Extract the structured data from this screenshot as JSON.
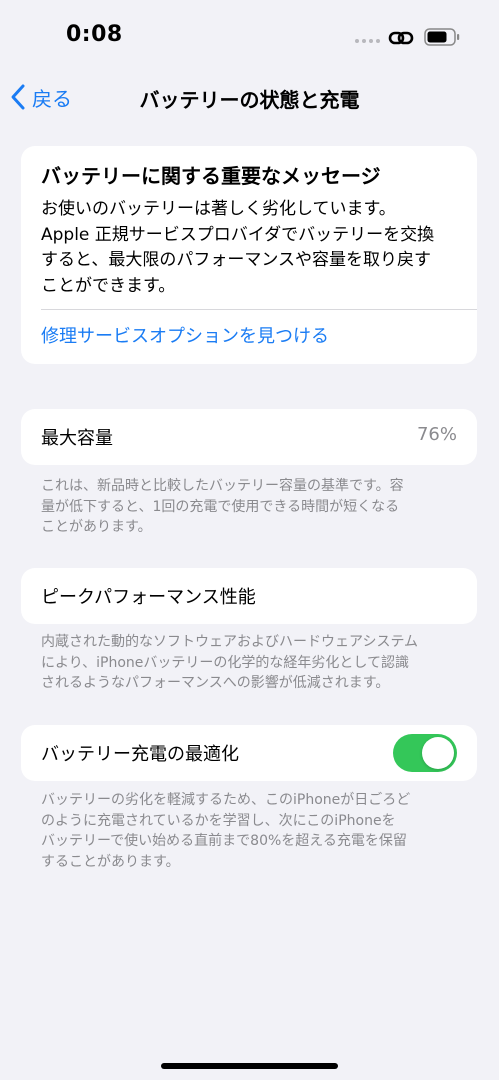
{
  "status_bar": {
    "time": "0:08"
  },
  "nav": {
    "back_label": "戻る",
    "title": "バッテリーの状態と充電"
  },
  "important_message": {
    "title": "バッテリーに関する重要なメッセージ",
    "body_lines": [
      "お使いのバッテリーは著しく劣化しています。",
      "Apple 正規サービスプロバイダでバッテリーを交換",
      "すると、最大限のパフォーマンスや容量を取り戻す",
      "ことができます。"
    ],
    "link": "修理サービスオプションを見つける"
  },
  "max_capacity": {
    "label": "最大容量",
    "value": "76%",
    "footnote_lines": [
      "これは、新品時と比較したバッテリー容量の基準です。容",
      "量が低下すると、1回の充電で使用できる時間が短くなる",
      "ことがあります。"
    ]
  },
  "peak_performance": {
    "label": "ピークパフォーマンス性能",
    "footnote_lines": [
      "内蔵された動的なソフトウェアおよびハードウェアシステム",
      "により、iPhoneバッテリーの化学的な経年劣化として認識",
      "されるようなパフォーマンスへの影響が低減されます。"
    ]
  },
  "optimized_charging": {
    "label": "バッテリー充電の最適化",
    "enabled": true,
    "footnote_lines": [
      "バッテリーの劣化を軽減するため、このiPhoneが日ごろど",
      "のように充電されているかを学習し、次にこのiPhoneを",
      "バッテリーで使い始める直前まで80%を超える充電を保留",
      "することがあります。"
    ]
  },
  "colors": {
    "accent": "#1a7cf4",
    "toggle_on": "#34c759",
    "background": "#f2f2f7",
    "secondary_text": "#8a8a8e"
  },
  "icons": {
    "back": "chevron-left-icon",
    "link": "link-icon",
    "battery": "battery-icon"
  }
}
